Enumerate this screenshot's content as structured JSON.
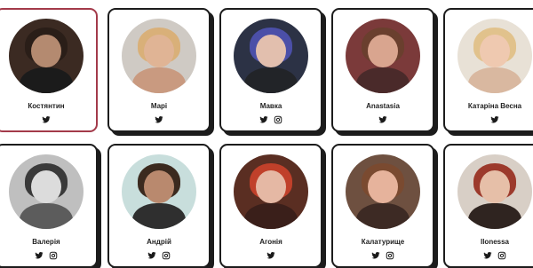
{
  "profiles": [
    {
      "name": "Костянтин",
      "twitter": true,
      "instagram": false,
      "colors": {
        "bg": "#3b2a22",
        "skin": "#b48a70",
        "hair": "#2a1e18",
        "clothes": "#1b1b1b"
      }
    },
    {
      "name": "Марі",
      "twitter": true,
      "instagram": false,
      "colors": {
        "bg": "#cfcac4",
        "skin": "#e0b495",
        "hair": "#d9b079",
        "clothes": "#c99a80"
      }
    },
    {
      "name": "Мавка",
      "twitter": true,
      "instagram": true,
      "colors": {
        "bg": "#2c3245",
        "skin": "#e2bfae",
        "hair": "#4b4fa8",
        "clothes": "#222428"
      }
    },
    {
      "name": "Anastasia",
      "twitter": true,
      "instagram": false,
      "colors": {
        "bg": "#7b3a3a",
        "skin": "#d9a58f",
        "hair": "#6a3f2e",
        "clothes": "#4a2a2a"
      }
    },
    {
      "name": "Катаріна Весна",
      "twitter": true,
      "instagram": false,
      "colors": {
        "bg": "#e8e1d6",
        "skin": "#efc9b0",
        "hair": "#e1c28c",
        "clothes": "#d9b8a0"
      }
    },
    {
      "name": "Валерія",
      "twitter": true,
      "instagram": true,
      "colors": {
        "bg": "#bfbfbf",
        "skin": "#dcdcdc",
        "hair": "#3a3a3a",
        "clothes": "#5c5c5c"
      }
    },
    {
      "name": "Андрій",
      "twitter": true,
      "instagram": true,
      "colors": {
        "bg": "#c8dedc",
        "skin": "#b9896e",
        "hair": "#3b2a1f",
        "clothes": "#2f2f2f"
      }
    },
    {
      "name": "Агонія",
      "twitter": true,
      "instagram": false,
      "colors": {
        "bg": "#5a2e22",
        "skin": "#e5b8a4",
        "hair": "#c0402a",
        "clothes": "#3a1f1a"
      }
    },
    {
      "name": "Калатурище",
      "twitter": true,
      "instagram": true,
      "colors": {
        "bg": "#6e5040",
        "skin": "#e6b39c",
        "hair": "#7a4a30",
        "clothes": "#3d2a24"
      }
    },
    {
      "name": "Ilonessa",
      "twitter": true,
      "instagram": true,
      "colors": {
        "bg": "#d8cfc6",
        "skin": "#e6bfa8",
        "hair": "#9c3a2c",
        "clothes": "#2f2420"
      }
    }
  ],
  "icons": {
    "twitter": "twitter-icon",
    "instagram": "instagram-icon"
  },
  "accent": "#a33a4a"
}
